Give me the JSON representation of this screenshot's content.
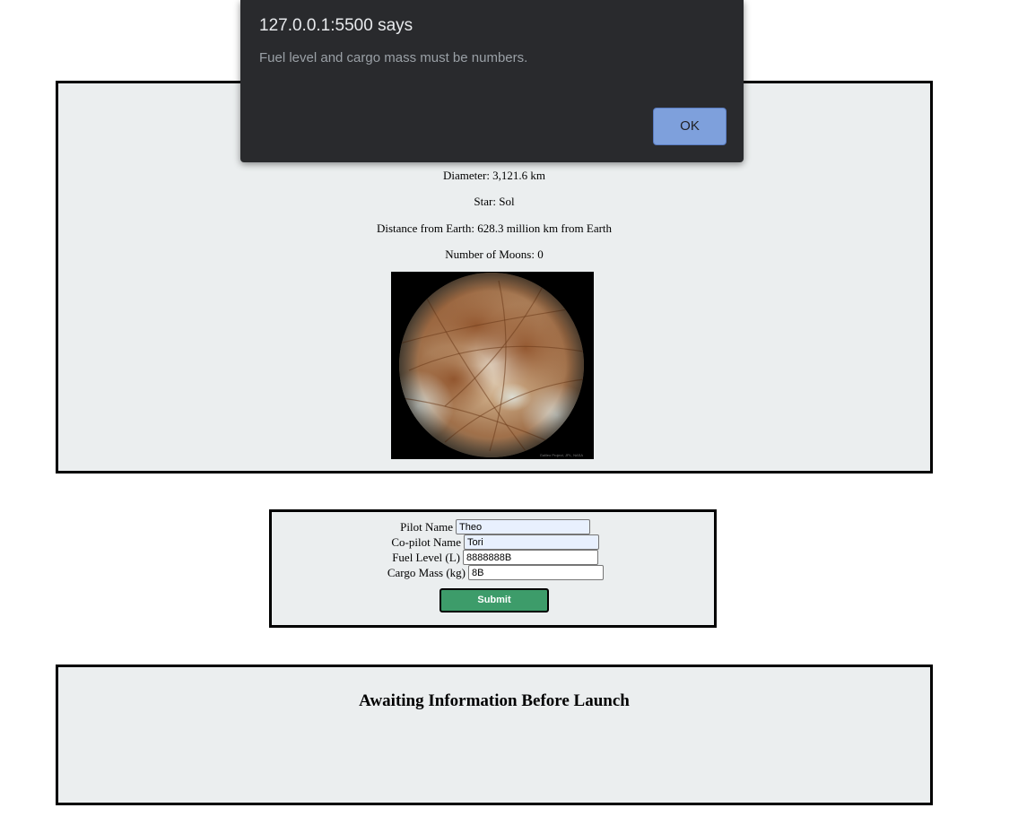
{
  "alert": {
    "title": "127.0.0.1:5500 says",
    "message": "Fuel level and cargo mass must be numbers.",
    "ok_label": "OK",
    "colors": {
      "background": "#292a2d",
      "title": "#e8eaed",
      "message": "#9aa0a6",
      "ok_button": "#7ea0dc"
    }
  },
  "mission_target": {
    "diameter": "Diameter: 3,121.6 km",
    "star": "Star: Sol",
    "distance": "Distance from Earth: 628.3 million km from Earth",
    "moons": "Number of Moons: 0",
    "image": {
      "icon": "planet-photo",
      "credit": "Galileo Project, JPL, NASA"
    }
  },
  "launch_form": {
    "pilot": {
      "label": "Pilot Name",
      "value": "Theo"
    },
    "copilot": {
      "label": "Co-pilot Name",
      "value": "Tori"
    },
    "fuel": {
      "label": "Fuel Level (L)",
      "value": "8888888B"
    },
    "cargo": {
      "label": "Cargo Mass (kg)",
      "value": "8B"
    },
    "submit_label": "Submit",
    "colors": {
      "submit": "#3d9c6a",
      "autofill": "#e8f0fe"
    }
  },
  "launch_status": {
    "heading": "Awaiting Information Before Launch"
  },
  "colors": {
    "panel_background": "#ebeeef",
    "panel_border": "#000000"
  }
}
